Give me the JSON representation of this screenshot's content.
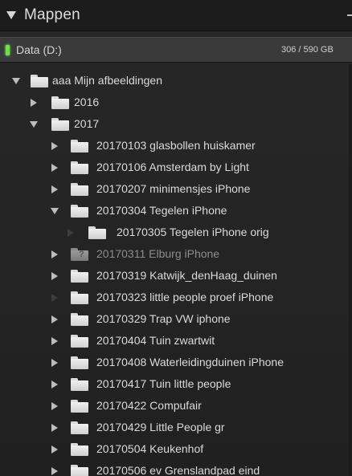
{
  "panel": {
    "title": "Mappen"
  },
  "volume": {
    "name": "Data (D:)",
    "usage": "306 / 590 GB"
  },
  "tree": [
    {
      "label": "aaa Mijn afbeeldingen",
      "level": 0,
      "arrow": "down",
      "dim": false,
      "folder": "normal"
    },
    {
      "label": "2016",
      "level": 1,
      "arrow": "right",
      "dim": false,
      "folder": "normal"
    },
    {
      "label": "2017",
      "level": 1,
      "arrow": "down",
      "dim": false,
      "folder": "normal"
    },
    {
      "label": "20170103 glasbollen huiskamer",
      "level": 2,
      "arrow": "right",
      "dim": false,
      "folder": "normal"
    },
    {
      "label": "20170106 Amsterdam by Light",
      "level": 2,
      "arrow": "right",
      "dim": false,
      "folder": "normal"
    },
    {
      "label": "20170207 minimensjes iPhone",
      "level": 2,
      "arrow": "right",
      "dim": false,
      "folder": "normal"
    },
    {
      "label": "20170304 Tegelen iPhone",
      "level": 2,
      "arrow": "down",
      "dim": false,
      "folder": "normal"
    },
    {
      "label": "20170305 Tegelen iPhone orig",
      "level": 3,
      "arrow": "none-dim",
      "dim": false,
      "folder": "normal"
    },
    {
      "label": "20170311 Elburg iPhone",
      "level": 2,
      "arrow": "right",
      "dim": true,
      "folder": "missing"
    },
    {
      "label": "20170319 Katwijk_denHaag_duinen",
      "level": 2,
      "arrow": "right",
      "dim": false,
      "folder": "normal"
    },
    {
      "label": "20170323 little people proef iPhone",
      "level": 2,
      "arrow": "none-dim",
      "dim": false,
      "folder": "normal"
    },
    {
      "label": "20170329 Trap VW iphone",
      "level": 2,
      "arrow": "right",
      "dim": false,
      "folder": "normal"
    },
    {
      "label": "20170404 Tuin zwartwit",
      "level": 2,
      "arrow": "right",
      "dim": false,
      "folder": "normal"
    },
    {
      "label": "20170408 Waterleidingduinen iPhone",
      "level": 2,
      "arrow": "right",
      "dim": false,
      "folder": "normal"
    },
    {
      "label": "20170417 Tuin little people",
      "level": 2,
      "arrow": "right",
      "dim": false,
      "folder": "normal"
    },
    {
      "label": "20170422 Compufair",
      "level": 2,
      "arrow": "right",
      "dim": false,
      "folder": "normal"
    },
    {
      "label": "20170429 Little People gr",
      "level": 2,
      "arrow": "right",
      "dim": false,
      "folder": "normal"
    },
    {
      "label": "20170504 Keukenhof",
      "level": 2,
      "arrow": "right",
      "dim": false,
      "folder": "normal"
    },
    {
      "label": "20170506 ev Grenslandpad eind",
      "level": 2,
      "arrow": "right",
      "dim": false,
      "folder": "normal"
    }
  ],
  "colors": {
    "background": "#232323",
    "header": "#1c1c1c",
    "volume_bar": "#3a3a3a",
    "online_indicator": "#6ee04a",
    "text": "#dadada",
    "text_dim": "#8d8d8d"
  },
  "icons": {
    "panel_toggle": "triangle-down-icon",
    "online": "volume-online-icon",
    "folder": "folder-icon",
    "missing_folder": "folder-missing-icon",
    "expand": "triangle-right-icon",
    "collapse": "triangle-down-icon"
  }
}
